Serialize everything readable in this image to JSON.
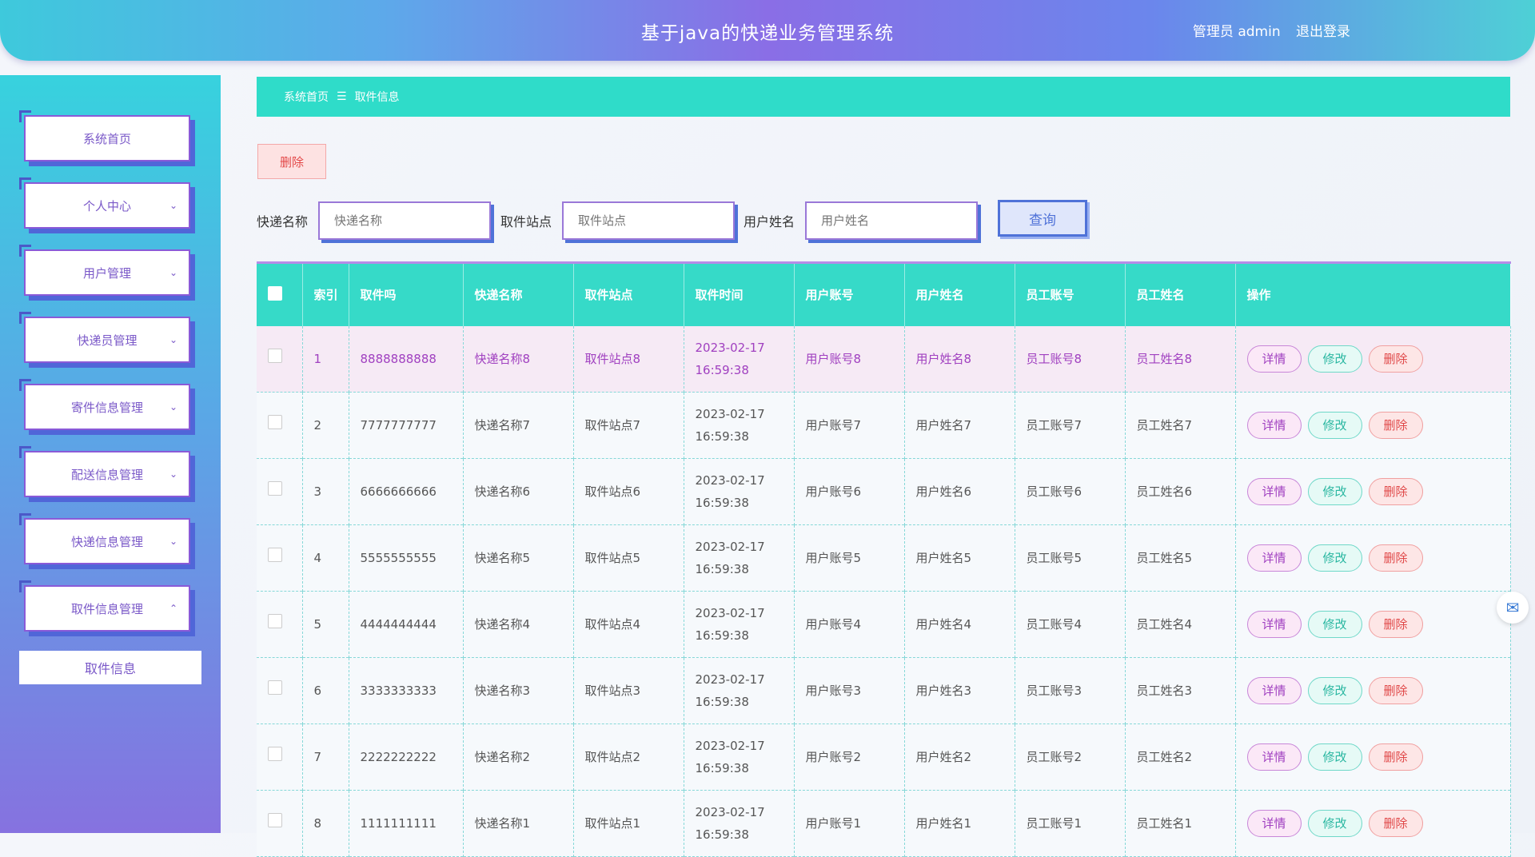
{
  "header": {
    "title": "基于java的快递业务管理系统",
    "user": "管理员 admin",
    "logout": "退出登录"
  },
  "sidebar": {
    "items": [
      {
        "label": "系统首页",
        "chevron": ""
      },
      {
        "label": "个人中心",
        "chevron": "⌄"
      },
      {
        "label": "用户管理",
        "chevron": "⌄"
      },
      {
        "label": "快递员管理",
        "chevron": "⌄"
      },
      {
        "label": "寄件信息管理",
        "chevron": "⌄"
      },
      {
        "label": "配送信息管理",
        "chevron": "⌄"
      },
      {
        "label": "快递信息管理",
        "chevron": "⌄"
      },
      {
        "label": "取件信息管理",
        "chevron": "⌃"
      }
    ],
    "submenu": "取件信息"
  },
  "breadcrumb": {
    "home": "系统首页",
    "sep": "☰",
    "current": "取件信息"
  },
  "toolbar": {
    "delete": "删除",
    "query": "查询"
  },
  "search": {
    "name_label": "快递名称",
    "name_placeholder": "快递名称",
    "site_label": "取件站点",
    "site_placeholder": "取件站点",
    "user_label": "用户姓名",
    "user_placeholder": "用户姓名"
  },
  "table": {
    "headers": [
      "索引",
      "取件吗",
      "快递名称",
      "取件站点",
      "取件时间",
      "用户账号",
      "用户姓名",
      "员工账号",
      "员工姓名",
      "操作"
    ],
    "actions": {
      "detail": "详情",
      "edit": "修改",
      "delete": "删除"
    },
    "rows": [
      {
        "index": "1",
        "code": "8888888888",
        "name": "快递名称8",
        "site": "取件站点8",
        "time": "2023-02-17 16:59:38",
        "account": "用户账号8",
        "uname": "用户姓名8",
        "staff": "员工账号8",
        "sname": "员工姓名8"
      },
      {
        "index": "2",
        "code": "7777777777",
        "name": "快递名称7",
        "site": "取件站点7",
        "time": "2023-02-17 16:59:38",
        "account": "用户账号7",
        "uname": "用户姓名7",
        "staff": "员工账号7",
        "sname": "员工姓名7"
      },
      {
        "index": "3",
        "code": "6666666666",
        "name": "快递名称6",
        "site": "取件站点6",
        "time": "2023-02-17 16:59:38",
        "account": "用户账号6",
        "uname": "用户姓名6",
        "staff": "员工账号6",
        "sname": "员工姓名6"
      },
      {
        "index": "4",
        "code": "5555555555",
        "name": "快递名称5",
        "site": "取件站点5",
        "time": "2023-02-17 16:59:38",
        "account": "用户账号5",
        "uname": "用户姓名5",
        "staff": "员工账号5",
        "sname": "员工姓名5"
      },
      {
        "index": "5",
        "code": "4444444444",
        "name": "快递名称4",
        "site": "取件站点4",
        "time": "2023-02-17 16:59:38",
        "account": "用户账号4",
        "uname": "用户姓名4",
        "staff": "员工账号4",
        "sname": "员工姓名4"
      },
      {
        "index": "6",
        "code": "3333333333",
        "name": "快递名称3",
        "site": "取件站点3",
        "time": "2023-02-17 16:59:38",
        "account": "用户账号3",
        "uname": "用户姓名3",
        "staff": "员工账号3",
        "sname": "员工姓名3"
      },
      {
        "index": "7",
        "code": "2222222222",
        "name": "快递名称2",
        "site": "取件站点2",
        "time": "2023-02-17 16:59:38",
        "account": "用户账号2",
        "uname": "用户姓名2",
        "staff": "员工账号2",
        "sname": "员工姓名2"
      },
      {
        "index": "8",
        "code": "1111111111",
        "name": "快递名称1",
        "site": "取件站点1",
        "time": "2023-02-17 16:59:38",
        "account": "用户账号1",
        "uname": "用户姓名1",
        "staff": "员工账号1",
        "sname": "员工姓名1"
      }
    ]
  }
}
